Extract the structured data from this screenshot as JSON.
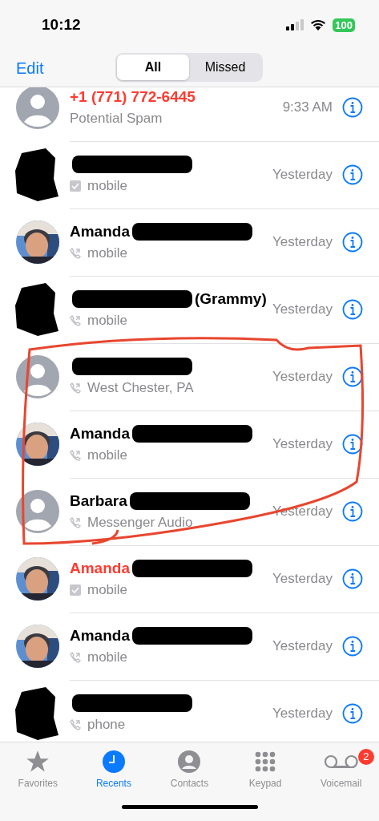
{
  "status_bar": {
    "time": "10:12",
    "battery": "100"
  },
  "header": {
    "edit": "Edit",
    "segments": [
      {
        "label": "All",
        "selected": true
      },
      {
        "label": "Missed",
        "selected": false
      }
    ]
  },
  "calls": [
    {
      "missed": true,
      "name_parts": [
        {
          "kind": "text",
          "text": "+1 (771) 772-6445"
        }
      ],
      "avatar": {
        "kind": "placeholder"
      },
      "detail": {
        "text": "Potential Spam"
      },
      "time": "9:33 AM"
    },
    {
      "name_parts": [
        {
          "kind": "redacted"
        }
      ],
      "avatar": {
        "kind": "redacted"
      },
      "detail": {
        "kind": "box",
        "text": "mobile"
      },
      "time": "Yesterday"
    },
    {
      "missed": false,
      "name_parts": [
        {
          "kind": "text",
          "text": "Amanda"
        },
        {
          "kind": "redacted"
        }
      ],
      "detail": {
        "kind": "phone",
        "text": "mobile"
      },
      "time": "Yesterday"
    },
    {
      "missed": false,
      "name_parts": [
        {
          "kind": "redacted"
        },
        {
          "kind": "text",
          "text": "(Grammy)"
        }
      ],
      "avatar": {
        "kind": "redacted"
      },
      "detail": {
        "kind": "phone",
        "text": "mobile"
      },
      "time": "Yesterday"
    },
    {
      "name_parts": [
        {
          "kind": "redacted"
        }
      ],
      "avatar": {
        "kind": "placeholder"
      },
      "detail": {
        "kind": "phone",
        "text": "West Chester, PA"
      },
      "time": "Yesterday"
    },
    {
      "missed": false,
      "name_parts": [
        {
          "kind": "text",
          "text": "Amanda"
        },
        {
          "kind": "redacted"
        }
      ],
      "detail": {
        "kind": "phone",
        "text": "mobile"
      },
      "time": "Yesterday"
    },
    {
      "missed": false,
      "name_parts": [
        {
          "kind": "text",
          "text": "Barbara"
        },
        {
          "kind": "redacted"
        }
      ],
      "avatar": {
        "kind": "placeholder"
      },
      "detail": {
        "kind": "phone",
        "text": "Messenger Audio"
      },
      "time": "Yesterday"
    },
    {
      "missed": true,
      "name_parts": [
        {
          "kind": "text",
          "text": "Amanda"
        },
        {
          "kind": "redacted"
        }
      ],
      "detail": {
        "kind": "box",
        "text": "mobile"
      },
      "time": "Yesterday"
    },
    {
      "missed": false,
      "name_parts": [
        {
          "kind": "text",
          "text": "Amanda"
        },
        {
          "kind": "redacted"
        }
      ],
      "detail": {
        "kind": "phone",
        "text": "mobile"
      },
      "time": "Yesterday"
    },
    {
      "name_parts": [
        {
          "kind": "redacted"
        }
      ],
      "avatar": {
        "kind": "redacted"
      },
      "detail": {
        "kind": "phone",
        "text": "phone"
      },
      "time": "Yesterday"
    }
  ],
  "tabs": [
    {
      "label": "Favorites",
      "selected": false
    },
    {
      "label": "Recents",
      "selected": true
    },
    {
      "label": "Contacts",
      "selected": false
    },
    {
      "label": "Keypad",
      "selected": false
    },
    {
      "label": "Voicemail",
      "selected": false,
      "badge": "2"
    }
  ]
}
